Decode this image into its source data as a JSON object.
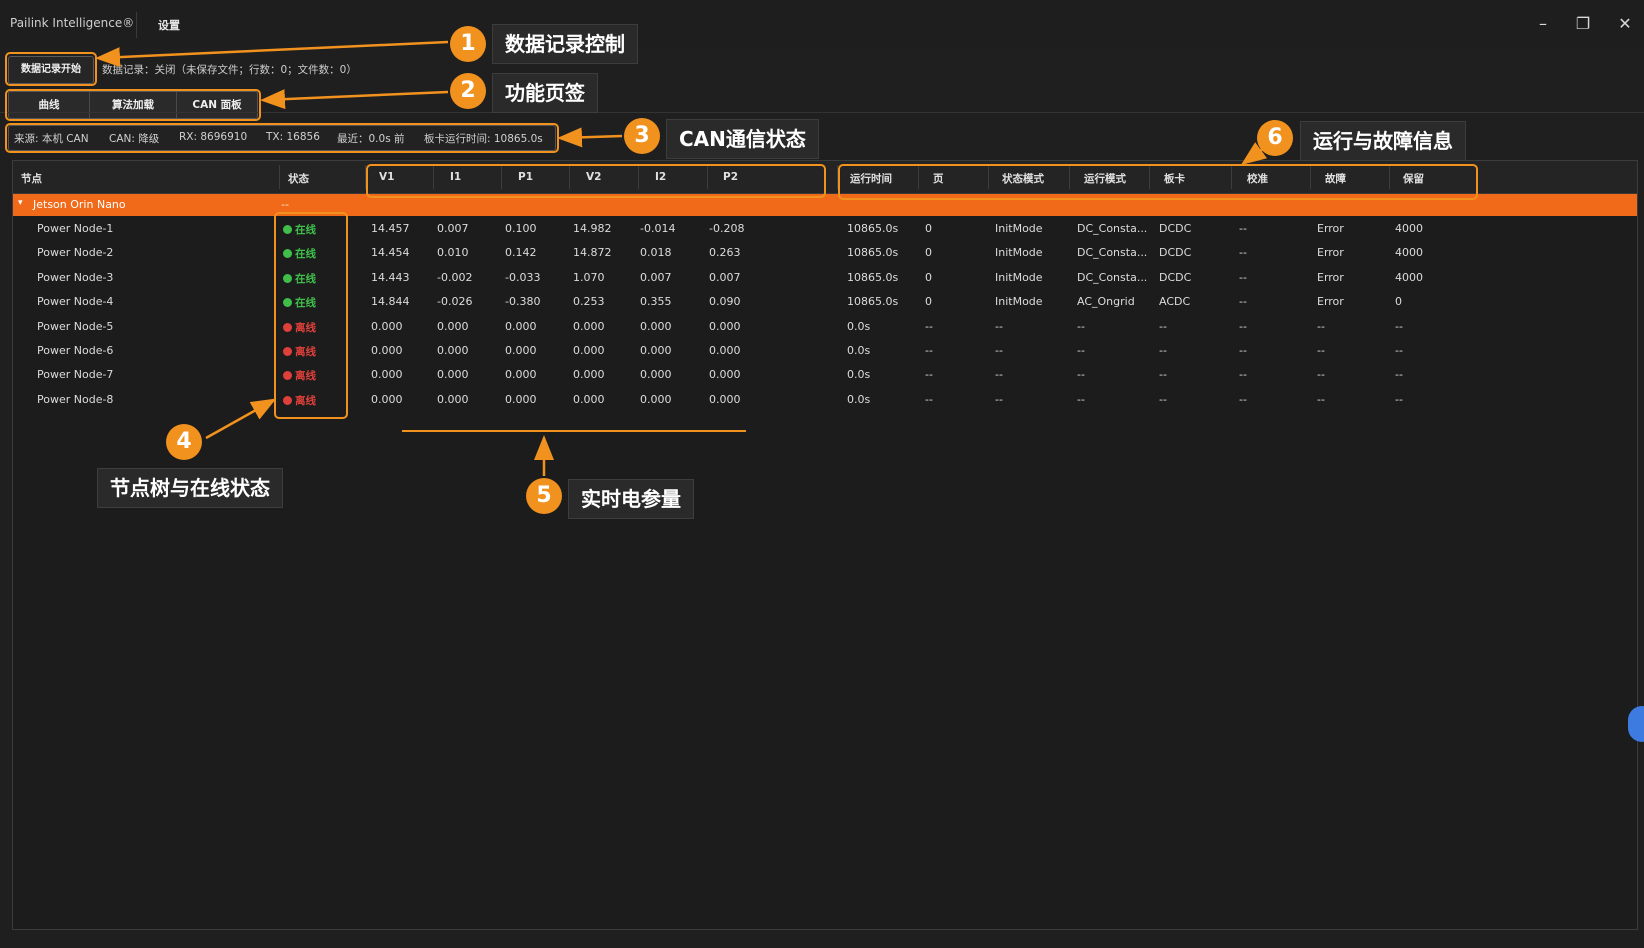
{
  "titlebar": {
    "app_title": "Pailink Intelligence®",
    "settings_menu": "设置",
    "minimize_glyph": "–",
    "restore_glyph": "❐",
    "close_glyph": "✕"
  },
  "toolbar": {
    "record_button": "数据记录开始",
    "record_status": "数据记录：关闭（未保存文件；行数：0；文件数：0）"
  },
  "tabs": [
    "曲线",
    "算法加载",
    "CAN 面板"
  ],
  "can_status": {
    "source": "来源: 本机 CAN",
    "can": "CAN: 降级",
    "rx": "RX: 8696910",
    "tx": "TX: 16856",
    "recent": "最近：0.0s 前",
    "uptime": "板卡运行时间: 10865.0s"
  },
  "table": {
    "headers": [
      "节点",
      "状态",
      "V1",
      "I1",
      "P1",
      "V2",
      "I2",
      "P2",
      "运行时间",
      "页",
      "状态模式",
      "运行模式",
      "板卡",
      "校准",
      "故障",
      "保留"
    ],
    "group": {
      "arrow": "▾",
      "label": "Jetson Orin Nano",
      "status": "--"
    },
    "status_colors": {
      "online": "#3fbf4a",
      "offline": "#e0403a"
    },
    "rows": [
      {
        "name": "Power Node-1",
        "state": "在线",
        "online": true,
        "v1": "14.457",
        "i1": "0.007",
        "p1": "0.100",
        "v2": "14.982",
        "i2": "-0.014",
        "p2": "-0.208",
        "runtime": "10865.0s",
        "page": "0",
        "state_mode": "InitMode",
        "run_mode": "DC_Consta...",
        "board": "DCDC",
        "calib": "--",
        "fault": "Error",
        "reserved": "4000"
      },
      {
        "name": "Power Node-2",
        "state": "在线",
        "online": true,
        "v1": "14.454",
        "i1": "0.010",
        "p1": "0.142",
        "v2": "14.872",
        "i2": "0.018",
        "p2": "0.263",
        "runtime": "10865.0s",
        "page": "0",
        "state_mode": "InitMode",
        "run_mode": "DC_Consta...",
        "board": "DCDC",
        "calib": "--",
        "fault": "Error",
        "reserved": "4000"
      },
      {
        "name": "Power Node-3",
        "state": "在线",
        "online": true,
        "v1": "14.443",
        "i1": "-0.002",
        "p1": "-0.033",
        "v2": "1.070",
        "i2": "0.007",
        "p2": "0.007",
        "runtime": "10865.0s",
        "page": "0",
        "state_mode": "InitMode",
        "run_mode": "DC_Consta...",
        "board": "DCDC",
        "calib": "--",
        "fault": "Error",
        "reserved": "4000"
      },
      {
        "name": "Power Node-4",
        "state": "在线",
        "online": true,
        "v1": "14.844",
        "i1": "-0.026",
        "p1": "-0.380",
        "v2": "0.253",
        "i2": "0.355",
        "p2": "0.090",
        "runtime": "10865.0s",
        "page": "0",
        "state_mode": "InitMode",
        "run_mode": "AC_Ongrid",
        "board": "ACDC",
        "calib": "--",
        "fault": "Error",
        "reserved": "0"
      },
      {
        "name": "Power Node-5",
        "state": "离线",
        "online": false,
        "v1": "0.000",
        "i1": "0.000",
        "p1": "0.000",
        "v2": "0.000",
        "i2": "0.000",
        "p2": "0.000",
        "runtime": "0.0s",
        "page": "--",
        "state_mode": "--",
        "run_mode": "--",
        "board": "--",
        "calib": "--",
        "fault": "--",
        "reserved": "--"
      },
      {
        "name": "Power Node-6",
        "state": "离线",
        "online": false,
        "v1": "0.000",
        "i1": "0.000",
        "p1": "0.000",
        "v2": "0.000",
        "i2": "0.000",
        "p2": "0.000",
        "runtime": "0.0s",
        "page": "--",
        "state_mode": "--",
        "run_mode": "--",
        "board": "--",
        "calib": "--",
        "fault": "--",
        "reserved": "--"
      },
      {
        "name": "Power Node-7",
        "state": "离线",
        "online": false,
        "v1": "0.000",
        "i1": "0.000",
        "p1": "0.000",
        "v2": "0.000",
        "i2": "0.000",
        "p2": "0.000",
        "runtime": "0.0s",
        "page": "--",
        "state_mode": "--",
        "run_mode": "--",
        "board": "--",
        "calib": "--",
        "fault": "--",
        "reserved": "--"
      },
      {
        "name": "Power Node-8",
        "state": "离线",
        "online": false,
        "v1": "0.000",
        "i1": "0.000",
        "p1": "0.000",
        "v2": "0.000",
        "i2": "0.000",
        "p2": "0.000",
        "runtime": "0.0s",
        "page": "--",
        "state_mode": "--",
        "run_mode": "--",
        "board": "--",
        "calib": "--",
        "fault": "--",
        "reserved": "--"
      }
    ]
  },
  "annotations": [
    {
      "number": "1",
      "label": "数据记录控制"
    },
    {
      "number": "2",
      "label": "功能页签"
    },
    {
      "number": "3",
      "label": "CAN通信状态"
    },
    {
      "number": "4",
      "label": "节点树与在线状态"
    },
    {
      "number": "5",
      "label": "实时电参量"
    },
    {
      "number": "6",
      "label": "运行与故障信息"
    }
  ],
  "accent_color": "#f2921e",
  "group_row_color": "#f06a1a"
}
